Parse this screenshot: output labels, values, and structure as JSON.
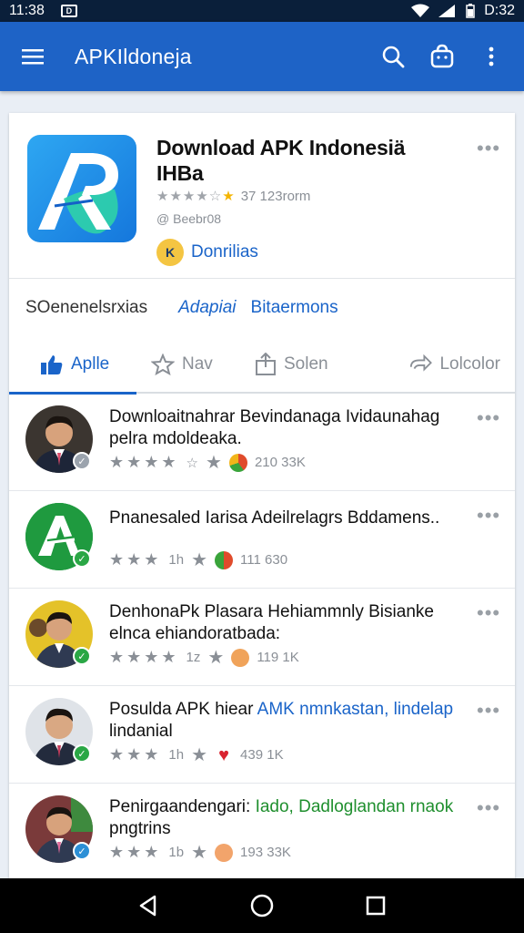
{
  "status_bar": {
    "time_left": "11:38",
    "time_right": "D:32",
    "badge": "D"
  },
  "app_bar": {
    "title": "APKIldoneja"
  },
  "featured": {
    "title_line1": "Download APK Indonesiä",
    "title_line2": "IHBa",
    "rating_text": "37 123rorm",
    "meta": "@ Beebr08",
    "developer": "Donrilias",
    "developer_badge": "K"
  },
  "categories": [
    "SOenenelsrxias",
    "Adapiai",
    "Bitaermons"
  ],
  "tabs": [
    {
      "label": "Aplle",
      "icon": "thumbs-up-icon"
    },
    {
      "label": "Nav",
      "icon": "star-outline-icon"
    },
    {
      "label": "Solen",
      "icon": "share-icon"
    },
    {
      "label": "Lolcolor",
      "icon": "forward-icon"
    }
  ],
  "list": [
    {
      "title": "Downloaitnahrar Bevindanaga Ividaunahag pelra mdoldeaka.",
      "title_hl": "",
      "title_tail": "",
      "stars": "★★★★",
      "half": "☆",
      "count": "210 33K",
      "avatar": "person",
      "verified_color": "#9ba3ad",
      "react_color": "#e04b2b",
      "hl_class": ""
    },
    {
      "title": "Pnanesaled Iarisa Adeilrelagrs Bddamens..",
      "title_hl": "",
      "title_tail": "",
      "stars": "★★★",
      "half": "1h",
      "count": "111 630",
      "avatar": "logo-green",
      "verified_color": "#2aa745",
      "react_color": "#e04b2b",
      "hl_class": ""
    },
    {
      "title": "DenhonaPk Plasara Hehiammnly Bisianke elnca ehiandoratbada:",
      "title_hl": "",
      "title_tail": "",
      "stars": "★★★★",
      "half": "1z",
      "count": "119 1K",
      "avatar": "person-yellow",
      "verified_color": "#2aa745",
      "react_color": "#f0a35a",
      "hl_class": ""
    },
    {
      "title": "Posulda APK hiear ",
      "title_hl": "AMK nmnkastan, lindelap",
      "title_tail": " lindanial",
      "stars": "★★★",
      "half": "1h",
      "count": "439 1K",
      "avatar": "person",
      "verified_color": "#2aa745",
      "react_color": "#d9232f",
      "hl_class": "hl-blue"
    },
    {
      "title": "Penirgaandengari: ",
      "title_hl": "Iado, Dadloglandan rnaok",
      "title_tail": " pngtrins",
      "stars": "★★★",
      "half": "1b",
      "count": "193 33K",
      "avatar": "person-red",
      "verified_color": "#2c8fd6",
      "react_color": "#f2a46b",
      "hl_class": "hl-green"
    }
  ],
  "colors": {
    "primary": "#1e63c6",
    "accent_blue": "#1a64c9",
    "accent_green": "#1f8f2e",
    "status_bar": "#0a1f3a"
  }
}
